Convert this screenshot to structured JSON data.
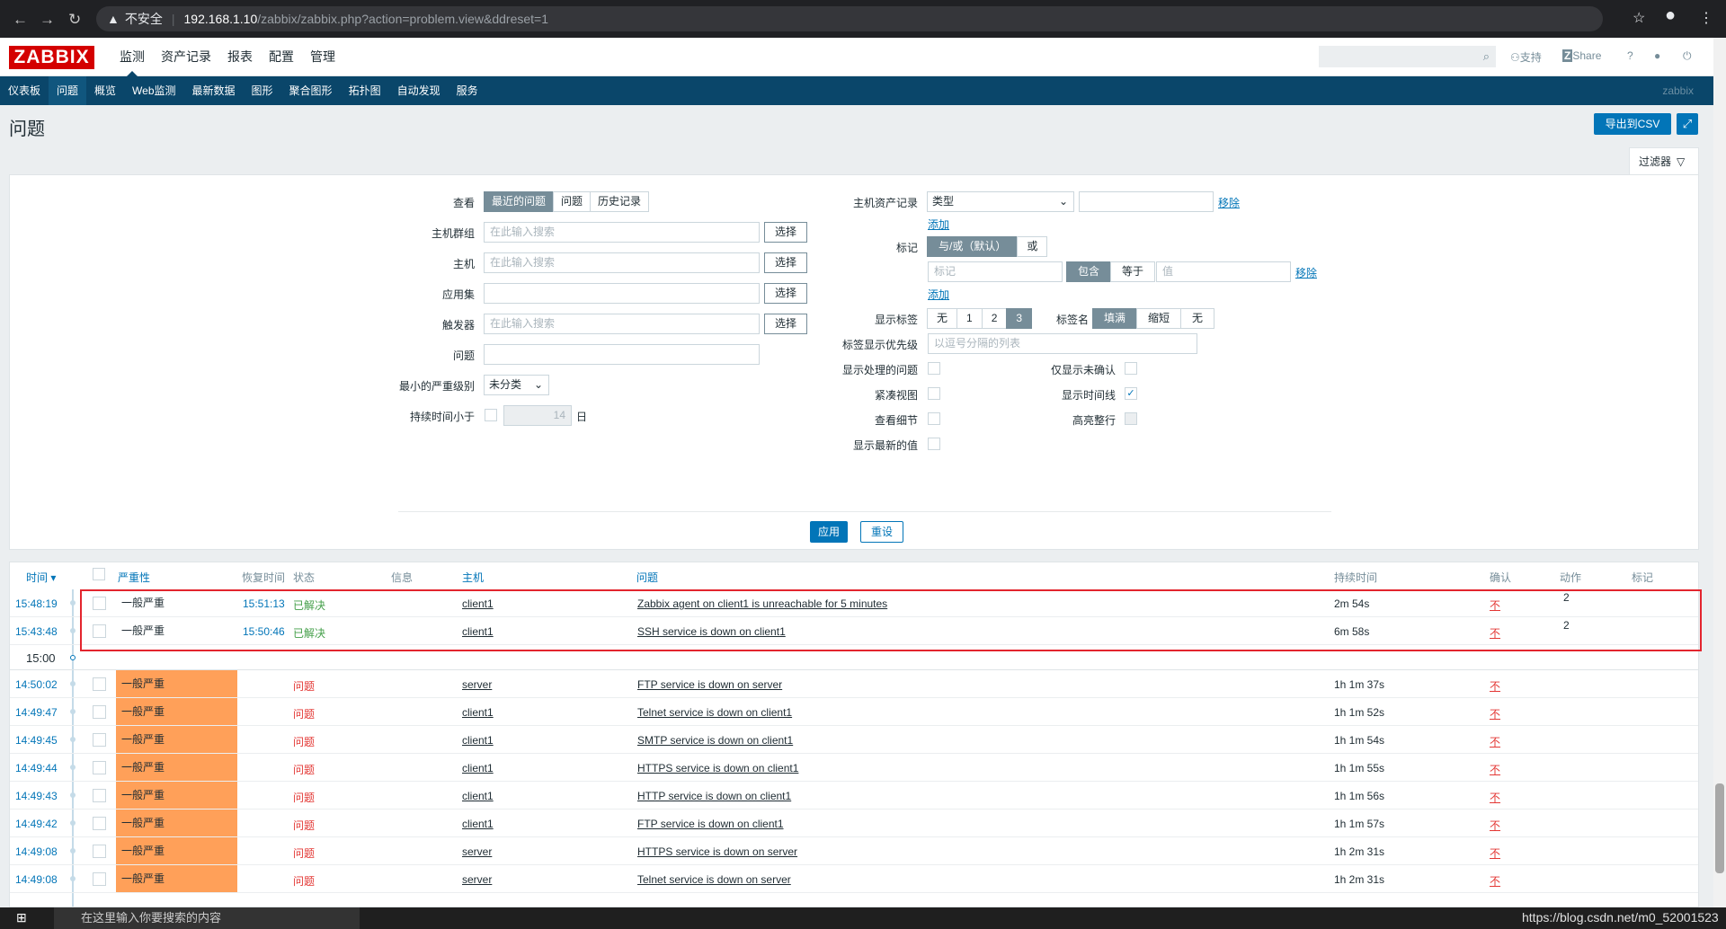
{
  "browser": {
    "insecure_label": "不安全",
    "url_host": "192.168.1.10",
    "url_path": "/zabbix/zabbix.php?action=problem.view&ddreset=1"
  },
  "topnav": {
    "logo": "ZABBIX",
    "menu": [
      "监测",
      "资产记录",
      "报表",
      "配置",
      "管理"
    ],
    "support": "支持",
    "share": "Share",
    "help": "?"
  },
  "submenu": {
    "items": [
      "仪表板",
      "问题",
      "概览",
      "Web监测",
      "最新数据",
      "图形",
      "聚合图形",
      "拓扑图",
      "自动发现",
      "服务"
    ],
    "brand": "zabbix"
  },
  "page": {
    "title": "问题",
    "export_csv": "导出到CSV",
    "filter_tab": "过滤器"
  },
  "filter": {
    "show_label": "查看",
    "show_options": [
      "最近的问题",
      "问题",
      "历史记录"
    ],
    "host_groups_label": "主机群组",
    "hosts_label": "主机",
    "application_label": "应用集",
    "triggers_label": "触发器",
    "problem_label": "问题",
    "min_severity_label": "最小的严重级别",
    "min_severity_value": "未分类",
    "age_label": "持续时间小于",
    "age_value": "14",
    "age_unit": "日",
    "placeholder": "在此输入搜索",
    "select_btn": "选择",
    "inventory_label": "主机资产记录",
    "inventory_type": "类型",
    "remove": "移除",
    "add": "添加",
    "tags_label": "标记",
    "tags_mode": [
      "与/或（默认）",
      "或"
    ],
    "tag_placeholder": "标记",
    "tag_ops": [
      "包含",
      "等于"
    ],
    "value_placeholder": "值",
    "show_tags_label": "显示标签",
    "show_tags_options": [
      "无",
      "1",
      "2",
      "3"
    ],
    "tag_name_label": "标签名",
    "tag_name_options": [
      "填满",
      "缩短",
      "无"
    ],
    "tag_priority_label": "标签显示优先级",
    "tag_priority_placeholder": "以逗号分隔的列表",
    "show_suppressed_label": "显示处理的问题",
    "unacknowledged_label": "仅显示未确认",
    "compact_view_label": "紧凑视图",
    "show_timeline_label": "显示时间线",
    "show_details_label": "查看细节",
    "highlight_row_label": "高亮整行",
    "show_latest_values_label": "显示最新的值",
    "apply": "应用",
    "reset": "重设"
  },
  "table": {
    "headers": {
      "time": "时间 ▾",
      "severity": "严重性",
      "recovery_time": "恢复时间",
      "status": "状态",
      "info": "信息",
      "host": "主机",
      "problem": "问题",
      "duration": "持续时间",
      "ack": "确认",
      "actions": "动作",
      "tags": "标记"
    },
    "resolved_rows": [
      {
        "time": "15:48:19",
        "severity": "一般严重",
        "recovery": "15:51:13",
        "status": "已解决",
        "host": "client1",
        "problem": "Zabbix agent on client1 is unreachable for 5 minutes",
        "duration": "2m 54s",
        "ack": "不",
        "actions": "2"
      },
      {
        "time": "15:43:48",
        "severity": "一般严重",
        "recovery": "15:50:46",
        "status": "已解决",
        "host": "client1",
        "problem": "SSH service is down on client1",
        "duration": "6m 58s",
        "ack": "不",
        "actions": "2"
      }
    ],
    "hour_marker": "15:00",
    "problem_rows": [
      {
        "time": "14:50:02",
        "severity": "一般严重",
        "status": "问题",
        "host": "server",
        "problem": "FTP service is down on server",
        "duration": "1h 1m 37s",
        "ack": "不"
      },
      {
        "time": "14:49:47",
        "severity": "一般严重",
        "status": "问题",
        "host": "client1",
        "problem": "Telnet service is down on client1",
        "duration": "1h 1m 52s",
        "ack": "不"
      },
      {
        "time": "14:49:45",
        "severity": "一般严重",
        "status": "问题",
        "host": "client1",
        "problem": "SMTP service is down on client1",
        "duration": "1h 1m 54s",
        "ack": "不"
      },
      {
        "time": "14:49:44",
        "severity": "一般严重",
        "status": "问题",
        "host": "client1",
        "problem": "HTTPS service is down on client1",
        "duration": "1h 1m 55s",
        "ack": "不"
      },
      {
        "time": "14:49:43",
        "severity": "一般严重",
        "status": "问题",
        "host": "client1",
        "problem": "HTTP service is down on client1",
        "duration": "1h 1m 56s",
        "ack": "不"
      },
      {
        "time": "14:49:42",
        "severity": "一般严重",
        "status": "问题",
        "host": "client1",
        "problem": "FTP service is down on client1",
        "duration": "1h 1m 57s",
        "ack": "不"
      },
      {
        "time": "14:49:08",
        "severity": "一般严重",
        "status": "问题",
        "host": "server",
        "problem": "HTTPS service is down on server",
        "duration": "1h 2m 31s",
        "ack": "不"
      },
      {
        "time": "14:49:08",
        "severity": "一般严重",
        "status": "问题",
        "host": "server",
        "problem": "Telnet service is down on server",
        "duration": "1h 2m 31s",
        "ack": "不"
      }
    ]
  },
  "taskbar": {
    "search_placeholder": "在这里输入你要搜索的内容",
    "watermark": "https://blog.csdn.net/m0_52001523"
  }
}
